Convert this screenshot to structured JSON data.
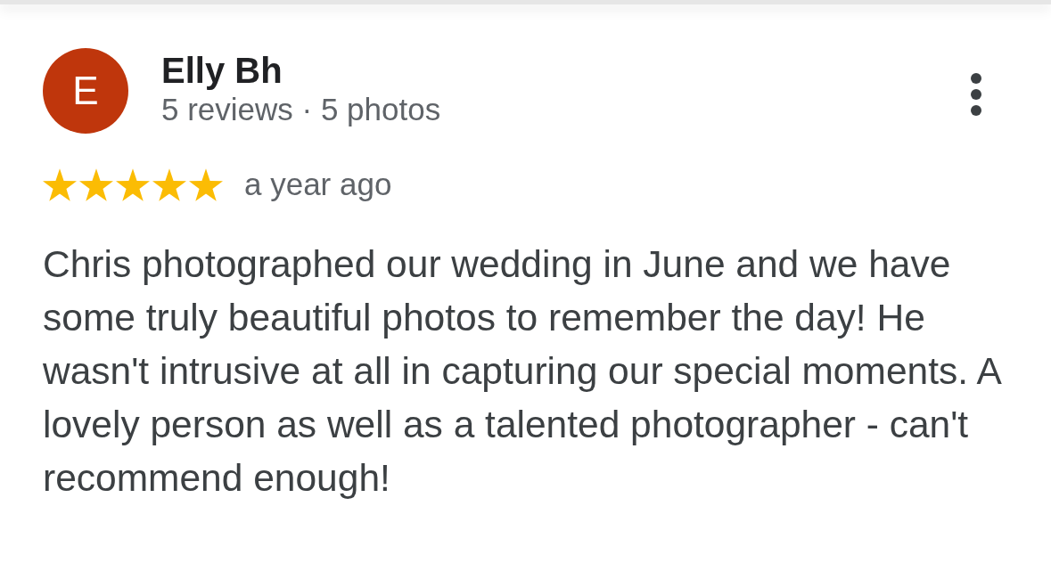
{
  "review": {
    "author": {
      "initial": "E",
      "name": "Elly Bh",
      "stats": "5 reviews · 5 photos"
    },
    "stars": 5,
    "time": "a year ago",
    "text": "Chris photographed our wedding in June and we have some truly beautiful photos to remember the day! He wasn't intrusive at all in capturing our special moments. A lovely person as well as a talented photographer - can't recommend enough!"
  }
}
